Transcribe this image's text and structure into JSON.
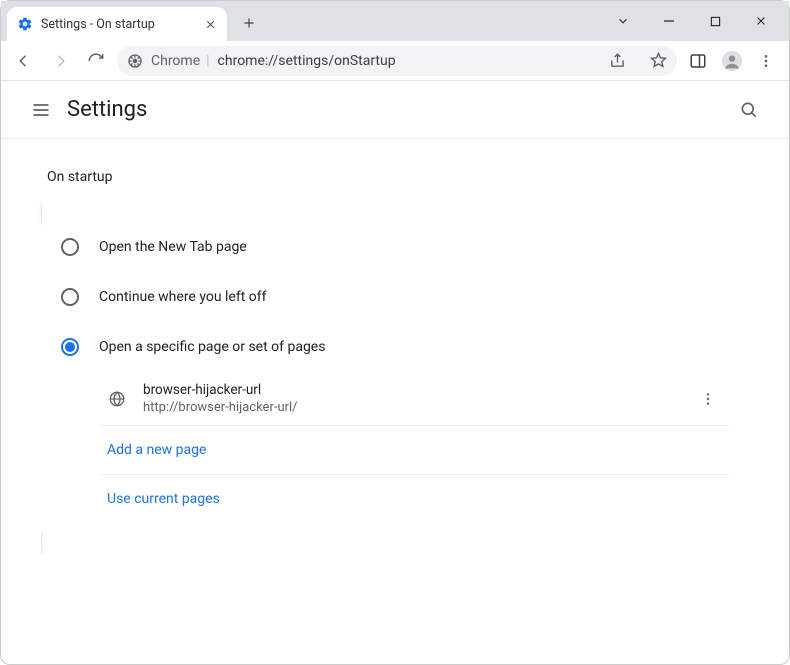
{
  "window": {
    "tab_title": "Settings - On startup"
  },
  "toolbar": {
    "url_label": "Chrome",
    "url_path": "chrome://settings/onStartup"
  },
  "header": {
    "title": "Settings"
  },
  "section": {
    "label": "On startup"
  },
  "options": {
    "newtab": "Open the New Tab page",
    "continue": "Continue where you left off",
    "specific": "Open a specific page or set of pages"
  },
  "page_entry": {
    "title": "browser-hijacker-url",
    "url": "http://browser-hijacker-url/"
  },
  "actions": {
    "add_page": "Add a new page",
    "use_current": "Use current pages"
  }
}
